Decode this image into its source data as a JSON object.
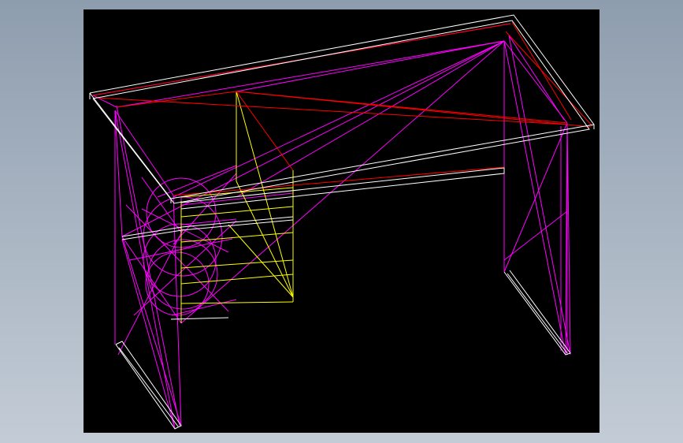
{
  "colors": {
    "background_top": "#8e9dae",
    "background_bottom": "#c3ccd6",
    "viewport": "#000000",
    "outline": "#ffffff",
    "construction": "#ff00ff",
    "accent": "#ff0000",
    "drawer": "#ffff00"
  }
}
